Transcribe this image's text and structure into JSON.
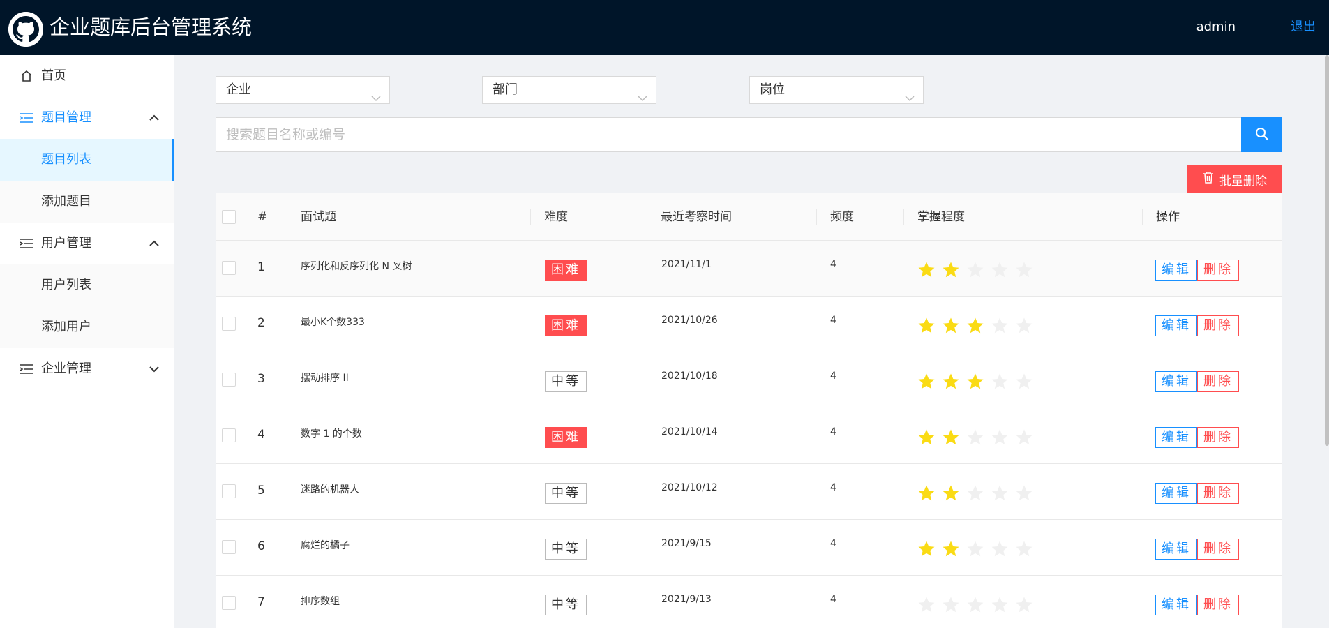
{
  "header": {
    "title": "企业题库后台管理系统",
    "user": "admin",
    "logout": "退出",
    "logo_icon": "github-icon"
  },
  "sidebar": {
    "items": [
      {
        "label": "首页",
        "icon": "home-icon"
      },
      {
        "label": "题目管理",
        "icon": "list-icon",
        "expanded": true
      },
      {
        "label": "题目列表",
        "active": true
      },
      {
        "label": "添加题目"
      },
      {
        "label": "用户管理",
        "icon": "list-icon",
        "expanded": true
      },
      {
        "label": "用户列表"
      },
      {
        "label": "添加用户"
      },
      {
        "label": "企业管理",
        "icon": "list-icon",
        "expanded": false
      }
    ]
  },
  "filters": {
    "company": "企业",
    "department": "部门",
    "position": "岗位"
  },
  "search": {
    "placeholder": "搜索题目名称或编号"
  },
  "actions": {
    "batch_delete": "批量删除"
  },
  "table": {
    "headers": {
      "index": "#",
      "question": "面试题",
      "difficulty": "难度",
      "last_time": "最近考察时间",
      "frequency": "频度",
      "mastery": "掌握程度",
      "ops": "操作"
    },
    "edit_label": "编辑",
    "delete_label": "删除",
    "rows": [
      {
        "index": "1",
        "question": "序列化和反序列化 N 叉树",
        "difficulty": "困难",
        "level": "hard",
        "last_time": "2021/11/1",
        "frequency": "4",
        "stars": 2
      },
      {
        "index": "2",
        "question": "最小K个数333",
        "difficulty": "困难",
        "level": "hard",
        "last_time": "2021/10/26",
        "frequency": "4",
        "stars": 3
      },
      {
        "index": "3",
        "question": "摆动排序 II",
        "difficulty": "中等",
        "level": "medium",
        "last_time": "2021/10/18",
        "frequency": "4",
        "stars": 3
      },
      {
        "index": "4",
        "question": "数字 1 的个数",
        "difficulty": "困难",
        "level": "hard",
        "last_time": "2021/10/14",
        "frequency": "4",
        "stars": 2
      },
      {
        "index": "5",
        "question": "迷路的机器人",
        "difficulty": "中等",
        "level": "medium",
        "last_time": "2021/10/12",
        "frequency": "4",
        "stars": 2
      },
      {
        "index": "6",
        "question": "腐烂的橘子",
        "difficulty": "中等",
        "level": "medium",
        "last_time": "2021/9/15",
        "frequency": "4",
        "stars": 2
      },
      {
        "index": "7",
        "question": "排序数组",
        "difficulty": "中等",
        "level": "medium",
        "last_time": "2021/9/13",
        "frequency": "4",
        "stars": 0
      }
    ]
  },
  "colors": {
    "primary": "#1890ff",
    "danger": "#ff4d4f",
    "header_bg": "#001529",
    "star_on": "#fadb14",
    "star_off": "#f0f0f0"
  }
}
